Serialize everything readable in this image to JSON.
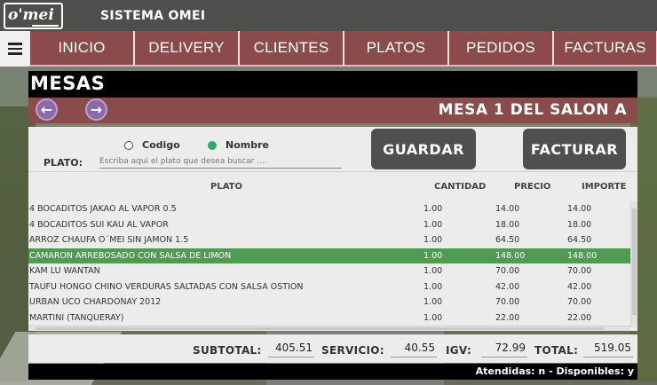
{
  "header": {
    "logo_text": "o'mei",
    "app_title": "SISTEMA OMEI"
  },
  "nav": {
    "menu_icon": "hamburger-menu-icon",
    "tabs": [
      {
        "label": "INICIO"
      },
      {
        "label": "DELIVERY"
      },
      {
        "label": "CLIENTES"
      },
      {
        "label": "PLATOS"
      },
      {
        "label": "PEDIDOS"
      },
      {
        "label": "FACTURAS"
      }
    ]
  },
  "mesas": {
    "title": "MESAS",
    "prev_icon": "arrow-left-icon",
    "next_icon": "arrow-right-icon",
    "mesa_label": "MESA 1 DEL SALON A"
  },
  "search": {
    "radio_codigo": "Codigo",
    "radio_nombre": "Nombre",
    "selected_mode": "Nombre",
    "plato_label": "PLATO:",
    "placeholder": "Escriba aqui el plato que desea buscar ....",
    "value": ""
  },
  "actions": {
    "guardar": "GUARDAR",
    "facturar": "FACTURAR"
  },
  "table": {
    "headers": {
      "plato": "PLATO",
      "cantidad": "CANTIDAD",
      "precio": "PRECIO",
      "importe": "IMPORTE"
    },
    "rows": [
      {
        "plato": "4 BOCADITOS JAKAO AL VAPOR 0.5",
        "cantidad": "1.00",
        "precio": "14.00",
        "importe": "14.00"
      },
      {
        "plato": "4 BOCADITOS SUI KAU AL VAPOR",
        "cantidad": "1.00",
        "precio": "18.00",
        "importe": "18.00"
      },
      {
        "plato": "ARROZ CHAUFA O´MEI SIN JAMON 1.5",
        "cantidad": "1.00",
        "precio": "64.50",
        "importe": "64.50"
      },
      {
        "plato": "CAMARON ARREBOSADO CON SALSA DE LIMON",
        "cantidad": "1.00",
        "precio": "148.00",
        "importe": "148.00"
      },
      {
        "plato": "KAM LU WANTAN",
        "cantidad": "1.00",
        "precio": "70.00",
        "importe": "70.00"
      },
      {
        "plato": "TAUFU HONGO CHINO VERDURAS SALTADAS CON SALSA OSTION",
        "cantidad": "1.00",
        "precio": "42.00",
        "importe": "42.00"
      },
      {
        "plato": "URBAN UCO CHARDONAY 2012",
        "cantidad": "1.00",
        "precio": "70.00",
        "importe": "70.00"
      },
      {
        "plato": "MARTINI  (TANQUERAY)",
        "cantidad": "1.00",
        "precio": "22.00",
        "importe": "22.00"
      }
    ],
    "selected_row_index": 3
  },
  "totals": {
    "subtotal_label": "SUBTOTAL:",
    "subtotal": "405.51",
    "servicio_label": "SERVICIO:",
    "servicio": "40.55",
    "igv_label": "IGV:",
    "igv": "72.99",
    "total_label": "TOTAL:",
    "total": "519.05"
  },
  "status": {
    "text": "Atendidas: n - Disponibles: y"
  },
  "colors": {
    "nav_tab": "#8c4b4b",
    "selected_row": "#4f9b52",
    "dark_button": "#4f4f4f",
    "radio_active": "#2dab6a"
  }
}
